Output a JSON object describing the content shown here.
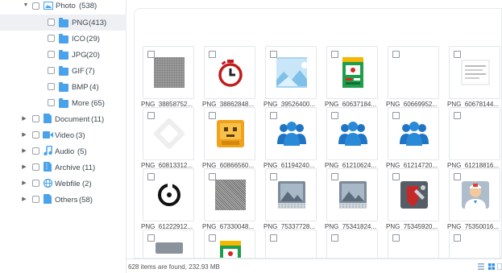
{
  "sidebar": {
    "items": [
      {
        "label": "Photo",
        "count": "(538)",
        "icon": "image-folder-icon",
        "expanded": true
      },
      {
        "label": "PNG",
        "count": "(413)",
        "icon": "folder-icon",
        "selected": true
      },
      {
        "label": "ICO",
        "count": "(29)",
        "icon": "folder-icon"
      },
      {
        "label": "JPG",
        "count": "(20)",
        "icon": "folder-icon"
      },
      {
        "label": "GIF",
        "count": "(7)",
        "icon": "folder-icon"
      },
      {
        "label": "BMP",
        "count": "(4)",
        "icon": "folder-icon"
      },
      {
        "label": "More",
        "count": "(65)",
        "icon": "folder-icon"
      },
      {
        "label": "Document",
        "count": "(11)",
        "icon": "document-icon"
      },
      {
        "label": "Video",
        "count": "(3)",
        "icon": "video-icon"
      },
      {
        "label": "Audio",
        "count": "(5)",
        "icon": "audio-icon"
      },
      {
        "label": "Archive",
        "count": "(11)",
        "icon": "archive-icon"
      },
      {
        "label": "Webfile",
        "count": "(2)",
        "icon": "globe-icon"
      },
      {
        "label": "Others",
        "count": "(58)",
        "icon": "others-icon"
      }
    ]
  },
  "files": [
    {
      "name": "PNG_38858752...",
      "thumb": "gray-pattern"
    },
    {
      "name": "PNG_38862848...",
      "thumb": "stopwatch-icon"
    },
    {
      "name": "PNG_39526400...",
      "thumb": "landscape-icon"
    },
    {
      "name": "PNG_60637184...",
      "thumb": "green-app-icon"
    },
    {
      "name": "PNG_60669952...",
      "thumb": "blank"
    },
    {
      "name": "PNG_60678144...",
      "thumb": "document-lines"
    },
    {
      "name": "PNG_60813312...",
      "thumb": "diamond-outline"
    },
    {
      "name": "PNG_60866560...",
      "thumb": "orange-face-icon"
    },
    {
      "name": "PNG_61194240...",
      "thumb": "users-icon"
    },
    {
      "name": "PNG_61210624...",
      "thumb": "users-icon"
    },
    {
      "name": "PNG_61214720...",
      "thumb": "users-icon"
    },
    {
      "name": "PNG_61218816...",
      "thumb": "blank"
    },
    {
      "name": "PNG_61222912...",
      "thumb": "disc-icon"
    },
    {
      "name": "PNG_67330048...",
      "thumb": "noise"
    },
    {
      "name": "PNG_75337728...",
      "thumb": "image-placeholder"
    },
    {
      "name": "PNG_75341824...",
      "thumb": "image-placeholder"
    },
    {
      "name": "PNG_75345920...",
      "thumb": "shield-tools-icon"
    },
    {
      "name": "PNG_75350016...",
      "thumb": "doctor-icon"
    },
    {
      "name": "",
      "thumb": "gray-box"
    },
    {
      "name": "",
      "thumb": "green-app-icon"
    },
    {
      "name": "",
      "thumb": "blank"
    },
    {
      "name": "",
      "thumb": "blank"
    },
    {
      "name": "",
      "thumb": "blank"
    },
    {
      "name": "",
      "thumb": "blank"
    }
  ],
  "status": {
    "text": "628 items are found, 232.93 MB"
  },
  "colors": {
    "accent": "#2f8fe3",
    "folder": "#4aa3ea",
    "selected_bg": "#eef0f3"
  }
}
